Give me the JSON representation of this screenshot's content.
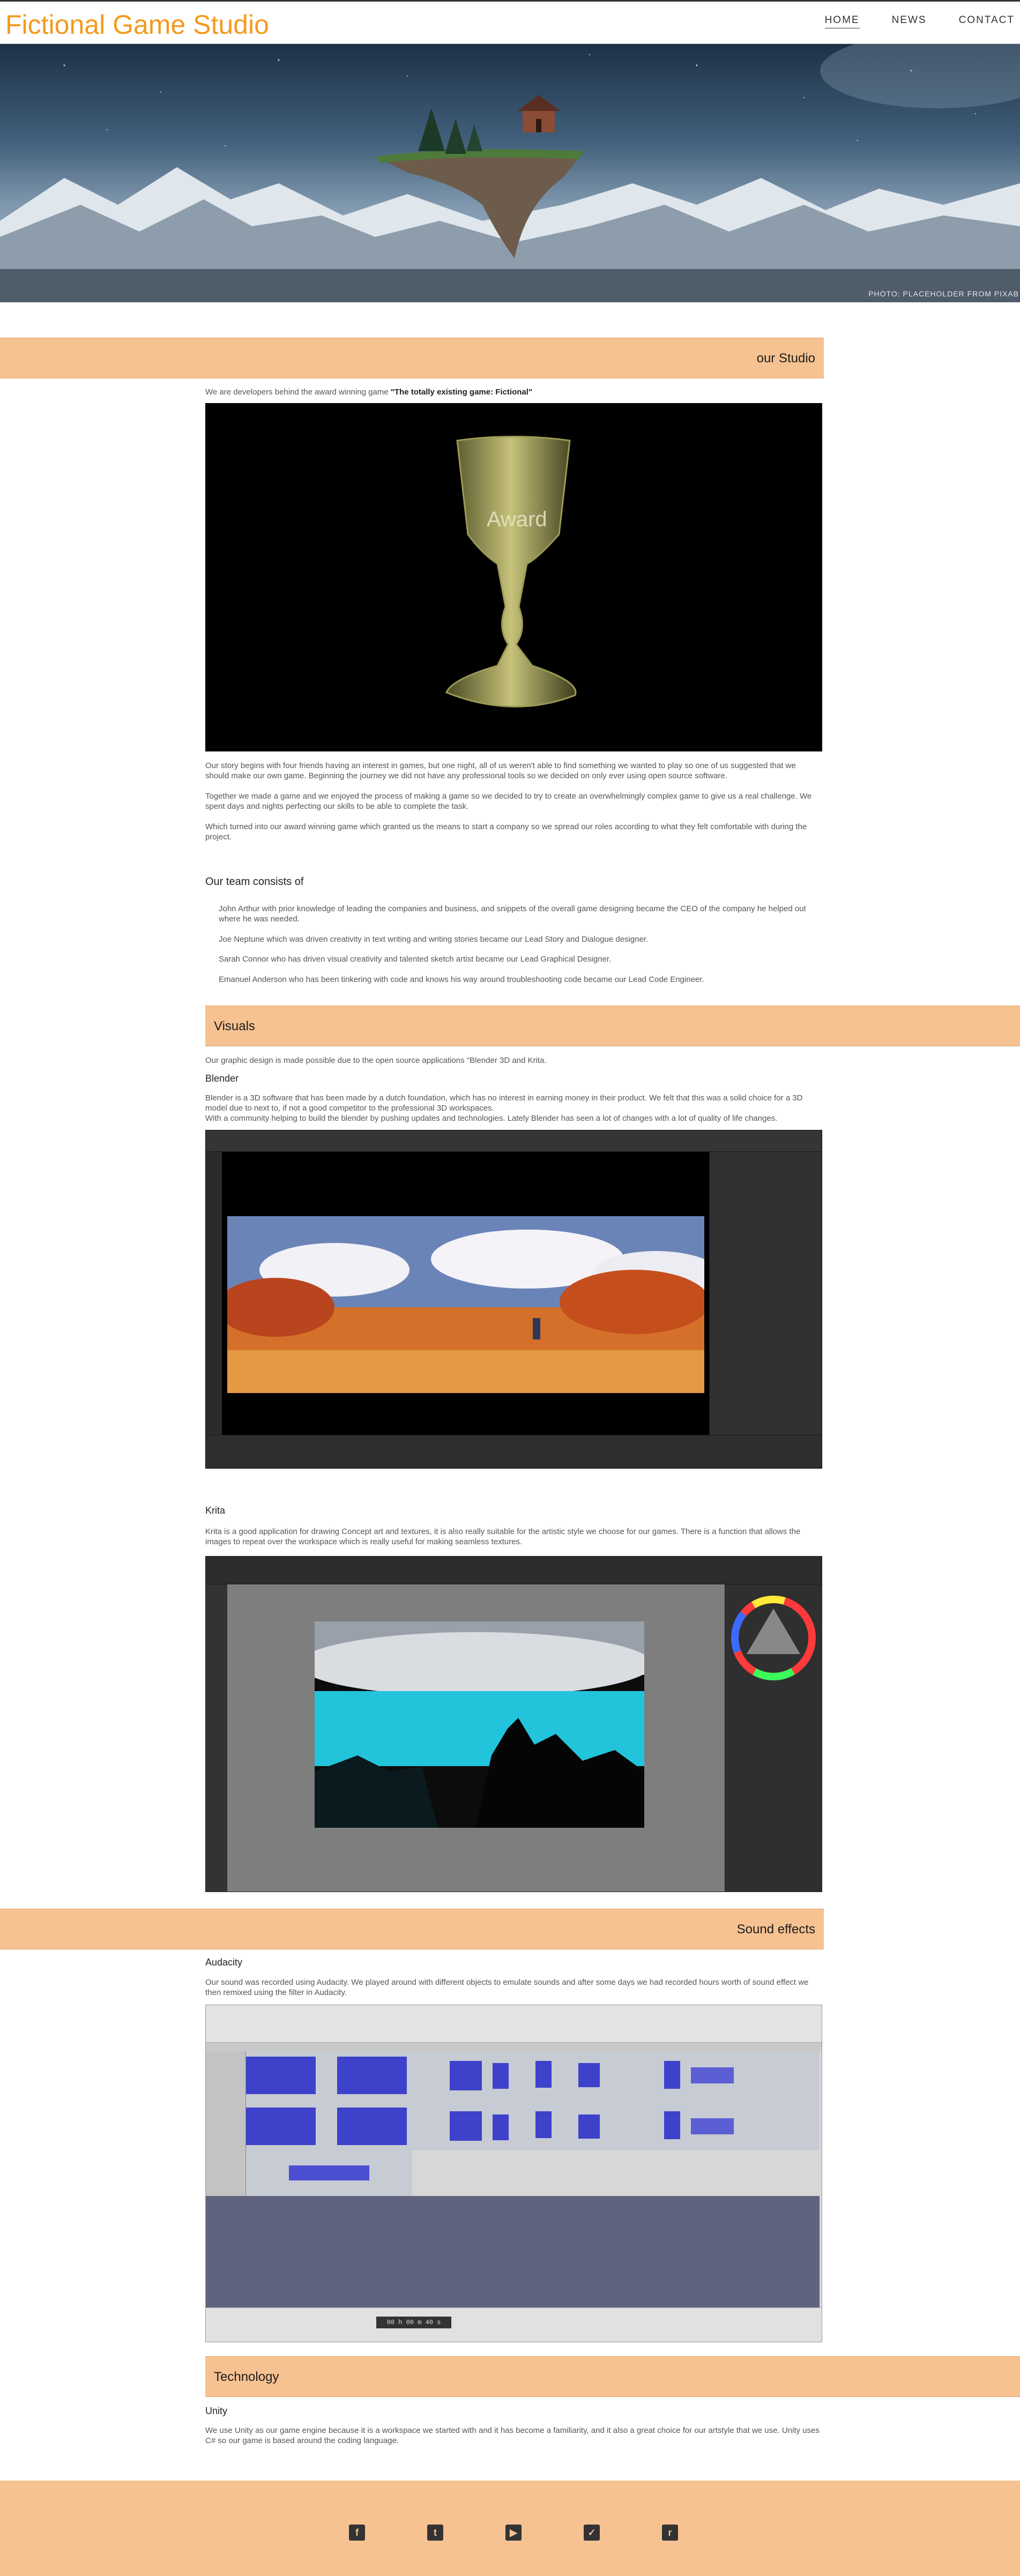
{
  "header": {
    "brand": "Fictional Game Studio",
    "nav": [
      {
        "label": "HOME",
        "active": true
      },
      {
        "label": "NEWS",
        "active": false
      },
      {
        "label": "CONTACT",
        "active": false
      }
    ]
  },
  "hero": {
    "credit": "PHOTO: PLACEHOLDER FROM PIXAB"
  },
  "studio": {
    "heading": "our Studio",
    "intro_prefix": "We are developers behind the award winning game ",
    "intro_game": "\"The totally existing game: Fictional\"",
    "award_label": "Award",
    "paragraphs": [
      "Our story begins with four friends having an interest in games, but one night, all of us weren't able to find something we wanted to play so one of us suggested that we should make our own game. Beginning the journey we did not have any professional tools so we decided on only ever using open source software.",
      "Together we made a game and we enjoyed the process of making a game so we decided to try to create an overwhelmingly complex game to give us a real challenge. We spent days and nights perfecting our skills to be able to complete the task.",
      "Which turned into our award winning game which granted us the means to start a company so we spread our roles according to what they felt comfortable with during the project."
    ],
    "team_heading": "Our team consists of",
    "team": [
      "John Arthur with prior knowledge of leading the companies and business, and snippets of the overall game designing became the CEO of the company he helped out where he was needed.",
      "Joe Neptune which was driven creativity in text writing and writing stories became our Lead Story and Dialogue designer.",
      "Sarah Connor who has driven visual creativity and talented sketch artist became our Lead Graphical Designer.",
      "Emanuel Anderson who has been tinkering with code and knows his way around troubleshooting code became our Lead Code Engineer."
    ]
  },
  "visuals": {
    "heading": "Visuals",
    "intro": "Our graphic design is made possible due to the open source applications \"Blender 3D and Krita.",
    "blender_title": "Blender",
    "blender_text": "Blender is a 3D software that has been made by a dutch foundation, which has no interest in earning money in their product. We felt that this was a solid choice for a 3D model due to next to, if not a good competitor to the professional 3D workspaces.",
    "blender_text2": "With a community helping to build the blender by pushing updates and technologies. Lately Blender has seen a lot of changes with a lot of quality of life changes.",
    "krita_title": "Krita",
    "krita_text": "Krita is a good application for drawing Concept art and textures, it is also really suitable for the artistic style we choose for our games. There is a function that allows the images to repeat over the workspace which is really useful for making seamless textures."
  },
  "sound": {
    "heading": "Sound effects",
    "audacity_title": "Audacity",
    "audacity_text": "Our sound was recorded using Audacity. We played around with different objects to emulate sounds and after some days we had recorded hours worth of sound effect we then remixed using the filter in Audacity.",
    "audacity_time": "00 h 00 m 40 s"
  },
  "technology": {
    "heading": "Technology",
    "unity_title": "Unity",
    "unity_text": "We use Unity as our game engine because it is a workspace we started with and it has become a familiarity, and it also a great choice for our artstyle that we use. Unity uses C# so our game is based around the coding language."
  },
  "footer": {
    "icons": [
      {
        "name": "facebook-icon",
        "glyph": "f"
      },
      {
        "name": "twitter-icon",
        "glyph": "t"
      },
      {
        "name": "youtube-icon",
        "glyph": "▶"
      },
      {
        "name": "checkin-icon",
        "glyph": "✓"
      },
      {
        "name": "reddit-icon",
        "glyph": "r"
      }
    ]
  },
  "colors": {
    "accent": "#f39a1d",
    "bar": "#f7c291",
    "bar_border": "#e1a56e"
  }
}
